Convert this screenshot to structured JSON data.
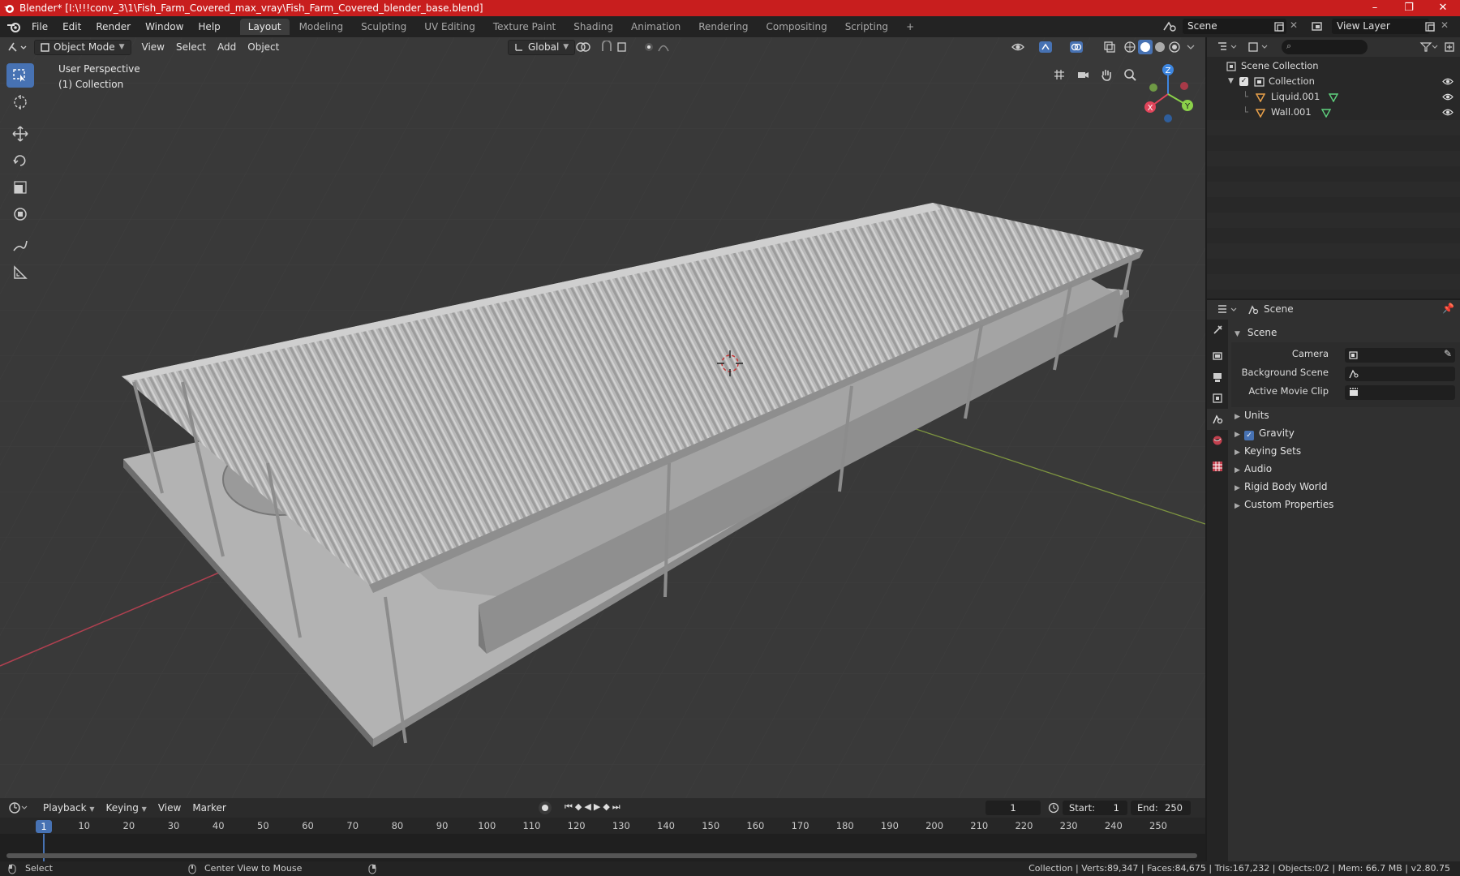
{
  "window": {
    "title": "Blender* [I:\\!!!conv_3\\1\\Fish_Farm_Covered_max_vray\\Fish_Farm_Covered_blender_base.blend]",
    "controls": [
      "–",
      "❐",
      "✕"
    ]
  },
  "menu": [
    "File",
    "Edit",
    "Render",
    "Window",
    "Help"
  ],
  "workspaces": [
    "Layout",
    "Modeling",
    "Sculpting",
    "UV Editing",
    "Texture Paint",
    "Shading",
    "Animation",
    "Rendering",
    "Compositing",
    "Scripting",
    "+"
  ],
  "active_workspace": "Layout",
  "scene_name": "Scene",
  "view_layer": "View Layer",
  "viewport": {
    "mode": "Object Mode",
    "menus": [
      "View",
      "Select",
      "Add",
      "Object"
    ],
    "orientation": "Global",
    "info_line1": "User Perspective",
    "info_line2": "(1) Collection",
    "tools": [
      "select-box-icon",
      "cursor-icon",
      "move-icon",
      "rotate-icon",
      "scale-icon",
      "transform-icon",
      "annotate-icon",
      "measure-icon"
    ],
    "gizmo_axes": [
      "X",
      "Y",
      "Z"
    ]
  },
  "outliner": {
    "root": "Scene Collection",
    "collection": "Collection",
    "objects": [
      "Liquid.001",
      "Wall.001"
    ]
  },
  "properties": {
    "header": "Scene",
    "panel": "Scene",
    "fields": [
      {
        "label": "Camera"
      },
      {
        "label": "Background Scene"
      },
      {
        "label": "Active Movie Clip"
      }
    ],
    "subpanels": [
      "Units",
      "Gravity",
      "Keying Sets",
      "Audio",
      "Rigid Body World",
      "Custom Properties"
    ],
    "gravity_checked": true
  },
  "timeline": {
    "menus": [
      "Playback",
      "Keying",
      "View",
      "Marker"
    ],
    "current_frame": "1",
    "start_label": "Start:",
    "start": "1",
    "end_label": "End:",
    "end": "250",
    "ticks": [
      "1",
      "10",
      "20",
      "30",
      "40",
      "50",
      "60",
      "70",
      "80",
      "90",
      "100",
      "110",
      "120",
      "130",
      "140",
      "150",
      "160",
      "170",
      "180",
      "190",
      "200",
      "210",
      "220",
      "230",
      "240",
      "250"
    ]
  },
  "status": {
    "left1": "Select",
    "left2": "Center View to Mouse",
    "right": "Collection | Verts:89,347 | Faces:84,675 | Tris:167,232 | Objects:0/2 | Mem: 66.7 MB | v2.80.75"
  },
  "colors": {
    "titlebar": "#c81e1e",
    "accent": "#4772b3",
    "viewport_bg": "#393939",
    "axis_x": "#e0445a",
    "axis_y": "#8bd14a",
    "axis_z": "#3d86e0"
  }
}
